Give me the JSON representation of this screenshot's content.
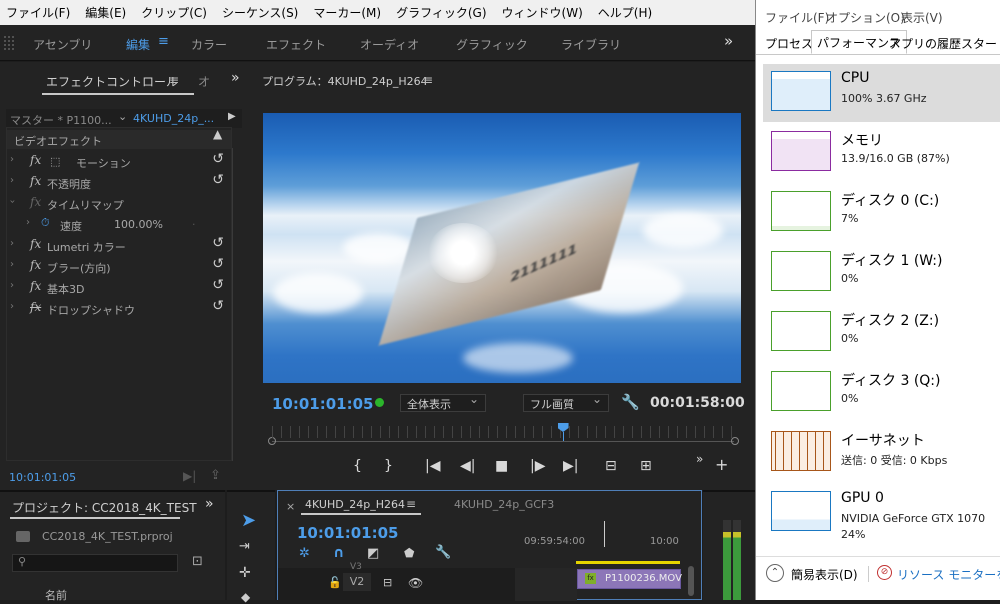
{
  "menubar": {
    "items": [
      "ファイル(F)",
      "編集(E)",
      "クリップ(C)",
      "シーケンス(S)",
      "マーカー(M)",
      "グラフィック(G)",
      "ウィンドウ(W)",
      "ヘルプ(H)"
    ]
  },
  "workspaces": {
    "items": [
      "アセンブリ",
      "編集",
      "カラー",
      "エフェクト",
      "オーディオ",
      "グラフィック",
      "ライブラリ"
    ],
    "active": "編集",
    "more": "»"
  },
  "effect_controls": {
    "tab_label": "エフェクトコントロール",
    "tab_next": "オ",
    "master_label": "マスター * P1100...",
    "sequence_label": "4KUHD_24p_...",
    "section_video": "ビデオエフェクト",
    "effects": [
      {
        "name": "モーション"
      },
      {
        "name": "不透明度"
      },
      {
        "name": "タイムリマップ"
      },
      {
        "name": "速度",
        "value": "100.00%"
      },
      {
        "name": "Lumetri カラー"
      },
      {
        "name": "ブラー(方向)"
      },
      {
        "name": "基本3D"
      },
      {
        "name": "ドロップシャドウ"
      }
    ],
    "timecode": "10:01:01:05"
  },
  "program": {
    "title": "プログラム：4KUHD_24p_H264",
    "timecode": "10:01:01:05",
    "zoom": "全体表示",
    "quality": "フル画質",
    "duration": "00:01:58:00",
    "playhead_fraction": 0.63,
    "status_color": "#2bb52b",
    "card_text": "2111111"
  },
  "project": {
    "title": "プロジェクト: CC2018_4K_TEST",
    "file": "CC2018_4K_TEST.prproj",
    "col_name": "名前"
  },
  "timeline": {
    "tab_active": "4KUHD_24p_H264",
    "tab_other": "4KUHD_24p_GCF3",
    "timecode": "10:01:01:05",
    "ruler_time1": "09:59:54:00",
    "ruler_time2": "10:00",
    "track": "V2",
    "track_above": "V3",
    "clip": "P1100236.MOV"
  },
  "task_manager": {
    "menu": [
      "ファイル(F)",
      "オプション(O)",
      "表示(V)"
    ],
    "tabs": [
      "プロセス",
      "パフォーマンス",
      "アプリの履歴",
      "スタートア"
    ],
    "active_tab": "パフォーマンス",
    "rows": [
      {
        "title": "CPU",
        "sub": "100%  3.67 GHz",
        "color": "#1a78c2"
      },
      {
        "title": "メモリ",
        "sub": "13.9/16.0 GB (87%)",
        "color": "#8b2ba0"
      },
      {
        "title": "ディスク 0 (C:)",
        "sub": "7%",
        "color": "#4aa02c"
      },
      {
        "title": "ディスク 1 (W:)",
        "sub": "0%",
        "color": "#4aa02c"
      },
      {
        "title": "ディスク 2 (Z:)",
        "sub": "0%",
        "color": "#4aa02c"
      },
      {
        "title": "ディスク 3 (Q:)",
        "sub": "0%",
        "color": "#4aa02c"
      },
      {
        "title": "イーサネット",
        "sub": "送信: 0 受信: 0 Kbps",
        "color": "#a7561a"
      },
      {
        "title": "GPU 0",
        "sub": "NVIDIA GeForce GTX 1070",
        "sub2": "24%",
        "color": "#1a78c2"
      }
    ],
    "footer_less": "簡易表示(D)",
    "footer_link": "リソース モニターを開く"
  }
}
